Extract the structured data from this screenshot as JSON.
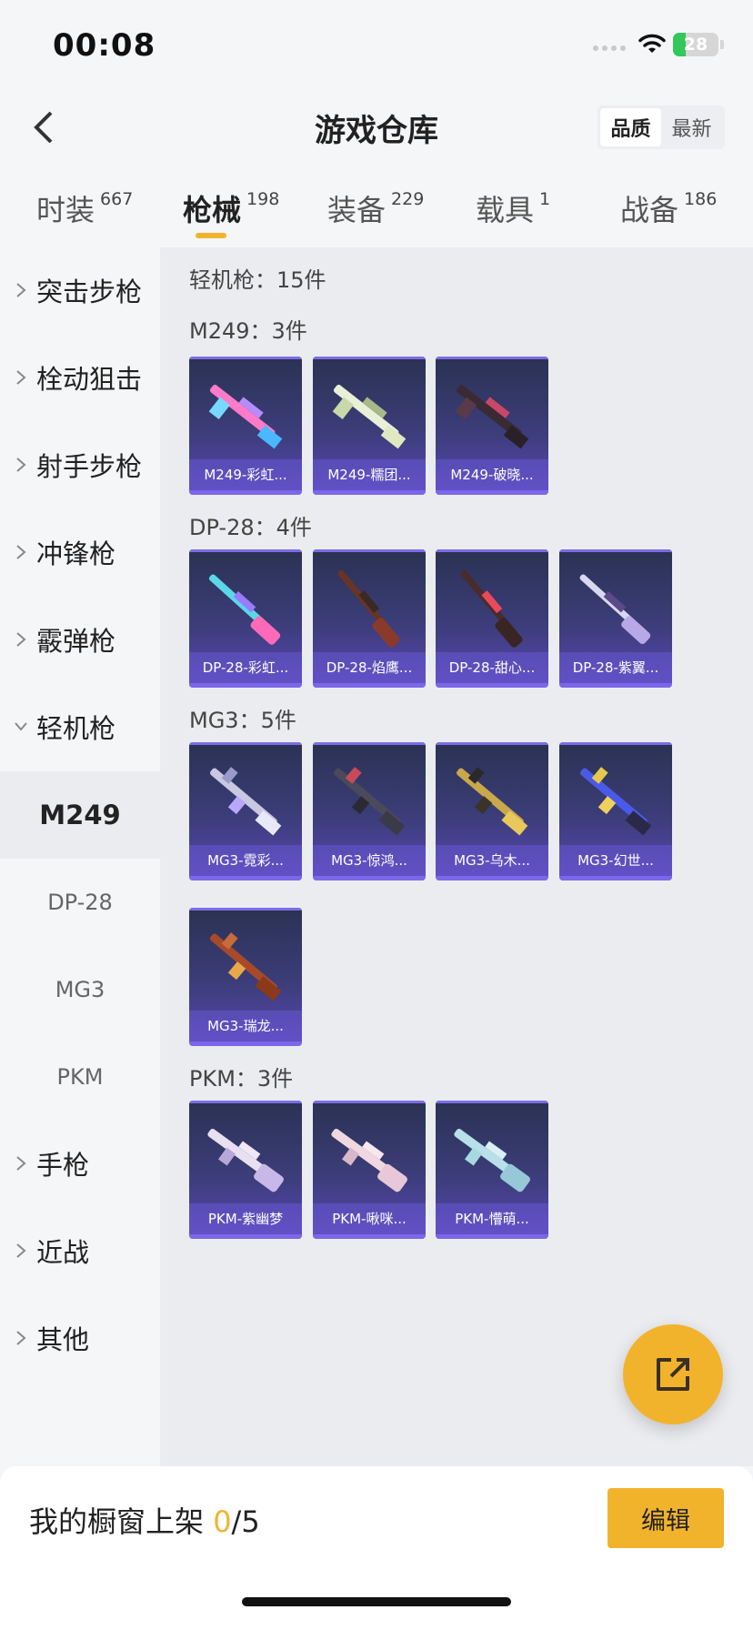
{
  "status_bar": {
    "time": "00:08",
    "battery": "28",
    "battery_level": 0.28
  },
  "nav": {
    "title": "游戏仓库",
    "sort_quality": "品质",
    "sort_newest": "最新"
  },
  "tabs": [
    {
      "label": "时装",
      "count": "667"
    },
    {
      "label": "枪械",
      "count": "198"
    },
    {
      "label": "装备",
      "count": "229"
    },
    {
      "label": "载具",
      "count": "1"
    },
    {
      "label": "战备",
      "count": "186"
    }
  ],
  "sidebar": {
    "items": [
      {
        "label": "突击步枪"
      },
      {
        "label": "栓动狙击"
      },
      {
        "label": "射手步枪"
      },
      {
        "label": "冲锋枪"
      },
      {
        "label": "霰弹枪"
      },
      {
        "label": "轻机枪"
      },
      {
        "label": "手枪"
      },
      {
        "label": "近战"
      },
      {
        "label": "其他"
      }
    ],
    "subitems": [
      {
        "label": "M249"
      },
      {
        "label": "DP-28"
      },
      {
        "label": "MG3"
      },
      {
        "label": "PKM"
      }
    ]
  },
  "content": {
    "category_header": "轻机枪：15件",
    "groups": [
      {
        "title": "M249：3件",
        "items": [
          "M249-彩虹...",
          "M249-糯团...",
          "M249-破晓..."
        ]
      },
      {
        "title": "DP-28：4件",
        "items": [
          "DP-28-彩虹...",
          "DP-28-焰鹰...",
          "DP-28-甜心...",
          "DP-28-紫翼..."
        ]
      },
      {
        "title": "MG3：5件",
        "items": [
          "MG3-霓彩...",
          "MG3-惊鸿...",
          "MG3-乌木...",
          "MG3-幻世...",
          "MG3-瑞龙..."
        ]
      },
      {
        "title": "PKM：3件",
        "items": [
          "PKM-紫幽梦",
          "PKM-啾咪...",
          "PKM-懵萌..."
        ]
      }
    ]
  },
  "bottom": {
    "label": "我的橱窗上架 ",
    "count": "0",
    "total": "/5",
    "edit": "编辑"
  },
  "colors": {
    "accent": "#f2b32c",
    "card_top": "#2a3252",
    "card_bottom": "#5a48b8"
  }
}
